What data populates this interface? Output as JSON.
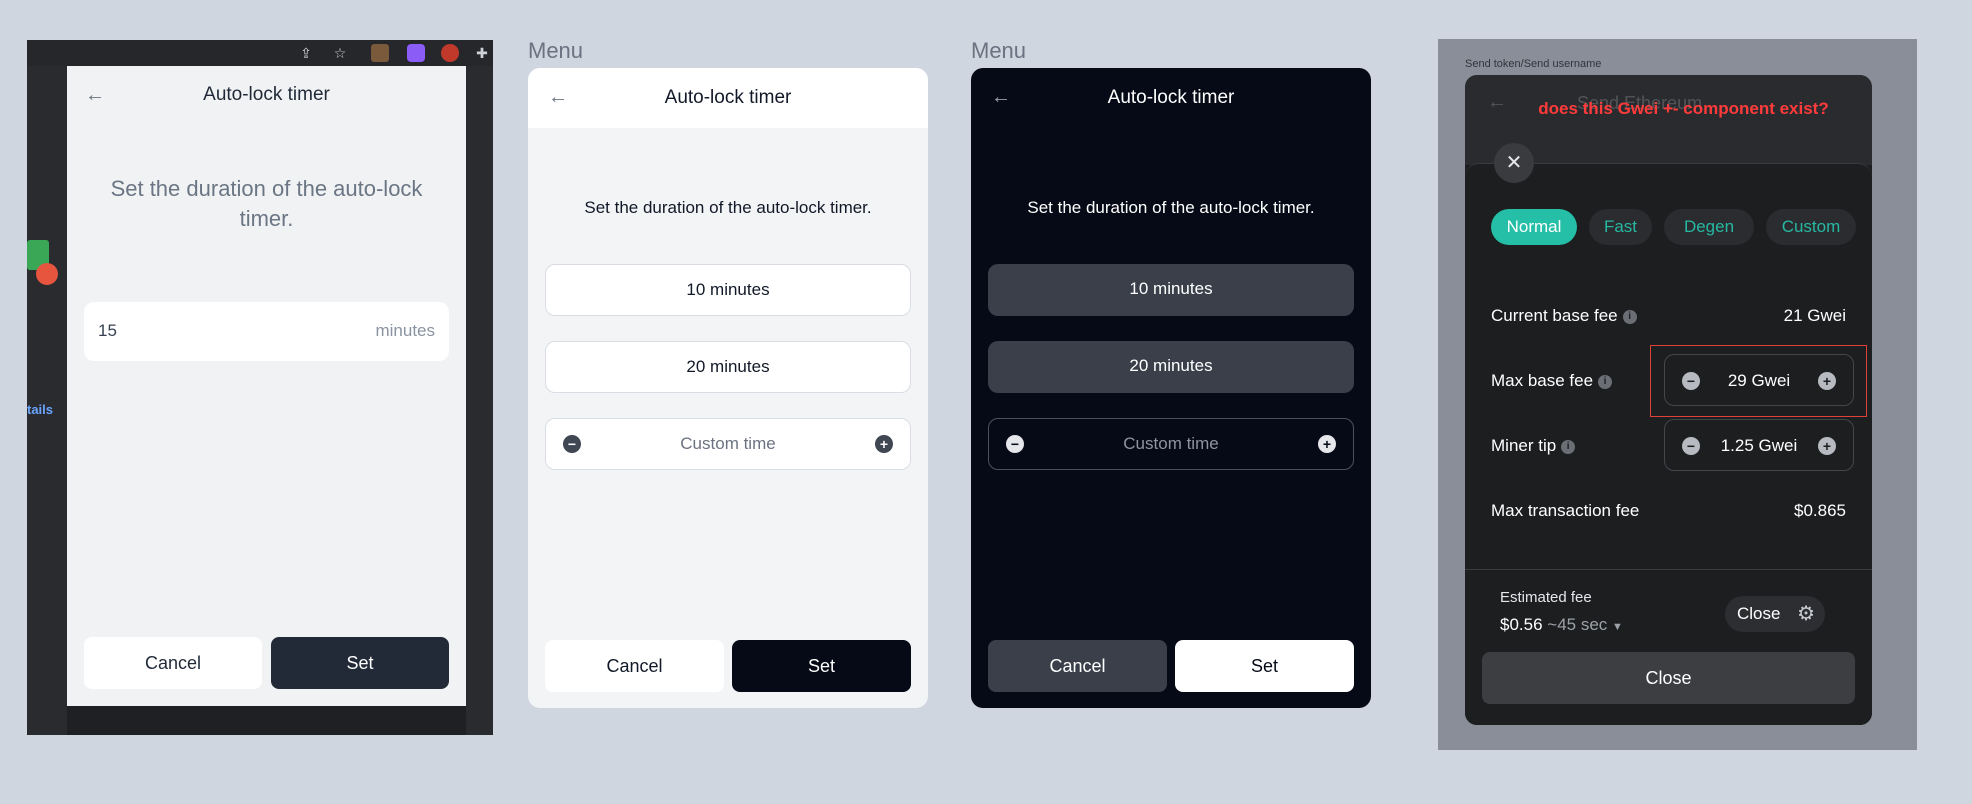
{
  "panel1": {
    "title": "Auto-lock timer",
    "description": "Set the duration of the auto-lock timer.",
    "input_value": "15",
    "input_unit": "minutes",
    "cancel_label": "Cancel",
    "set_label": "Set",
    "side_link": "tails",
    "back_icon": "←"
  },
  "panel2": {
    "menu_label": "Menu",
    "title": "Auto-lock timer",
    "description": "Set the duration of the auto-lock timer.",
    "options": [
      "10 minutes",
      "20 minutes"
    ],
    "custom_label": "Custom time",
    "cancel_label": "Cancel",
    "set_label": "Set",
    "back_icon": "←"
  },
  "panel3": {
    "menu_label": "Menu",
    "title": "Auto-lock timer",
    "description": "Set the duration of the auto-lock timer.",
    "options": [
      "10 minutes",
      "20 minutes"
    ],
    "custom_label": "Custom time",
    "cancel_label": "Cancel",
    "set_label": "Set",
    "back_icon": "←"
  },
  "panel4": {
    "breadcrumb": "Send token/Send username",
    "header_dim_text": "Send Ethereum",
    "annotation": "does this Gwei +- component exist?",
    "close_icon": "✕",
    "speed_options": [
      "Normal",
      "Fast",
      "Degen",
      "Custom"
    ],
    "selected_speed": "Normal",
    "current_base_fee_label": "Current base fee",
    "current_base_fee_value": "21 Gwei",
    "max_base_fee_label": "Max base fee",
    "max_base_fee_value": "29 Gwei",
    "miner_tip_label": "Miner tip",
    "miner_tip_value": "1.25 Gwei",
    "max_tx_fee_label": "Max transaction fee",
    "max_tx_fee_value": "$0.865",
    "estimated_fee_label": "Estimated fee",
    "estimated_fee_value": "$0.56",
    "estimated_time": "~45 sec",
    "close_chip_label": "Close",
    "close_button_label": "Close",
    "annotation_color": "#ff3b3b",
    "accent_color": "#25bea6"
  }
}
